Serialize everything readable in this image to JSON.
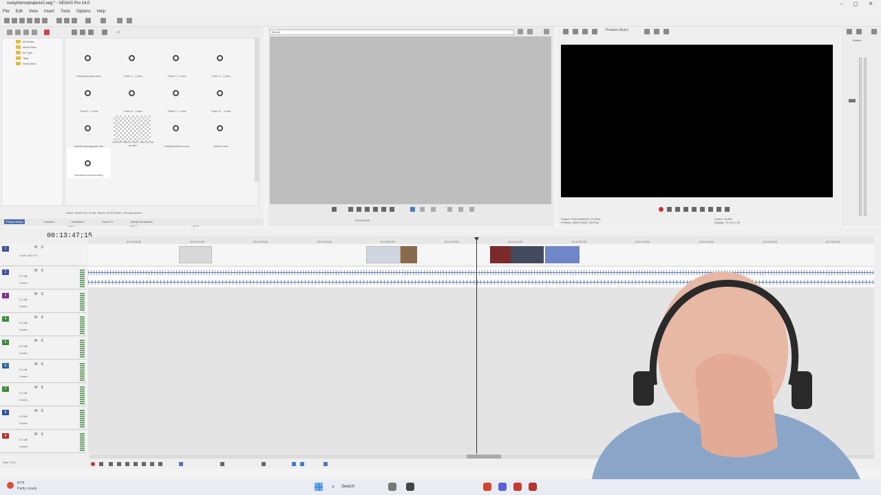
{
  "window": {
    "title": "rockyhorrorprojectv2.veg * - VEGAS Pro 14.0",
    "menus": [
      "File",
      "Edit",
      "View",
      "Insert",
      "Tools",
      "Options",
      "Help"
    ]
  },
  "media_tree": {
    "items": [
      "All Media",
      "Media Bins",
      "By Type",
      "Tags",
      "Smart Bins"
    ]
  },
  "media_items": [
    {
      "label": "theyveescaped.wav"
    },
    {
      "label": "Track 1 - 1.wav"
    },
    {
      "label": "Track 3 - 1.wav"
    },
    {
      "label": "Track 4 - 1.wav"
    },
    {
      "label": "Track 6 - 1.wav"
    },
    {
      "label": "Track 8 - 1.wav"
    },
    {
      "label": "Track 9 - 1.wav"
    },
    {
      "label": "Track 11 - 1.wav"
    },
    {
      "label": "transitionparagraph.wav"
    },
    {
      "label": "VEGAS Titles & Text 1 use my cat as filler"
    },
    {
      "label": "whatshouldnme.wav"
    },
    {
      "label": "whether.wav"
    },
    {
      "label": "wouldverrunthiscoming"
    }
  ],
  "shortcuts": {
    "col1": [
      "Ctrl+1",
      "Ctrl+2",
      "Ctrl+3"
    ],
    "col2": [
      "Ctrl+4",
      "Ctrl+5",
      "Ctrl+6"
    ],
    "col3": [
      "Ctrl+7",
      "Ctrl+8",
      "Ctrl+9"
    ],
    "col4": [
      "Ctrl"
    ]
  },
  "media_footer": "Audio: 48,000 Hz, 16 Bit, Stereo, 00:00:06;00, Uncompressed",
  "bottom_tabs": [
    "Project Media",
    "Explorer",
    "Transitions",
    "Video FX",
    "Media Generators"
  ],
  "trimmer": {
    "field": "(None)",
    "time": "00:00:00;00"
  },
  "preview": {
    "mode_label": "Preview (Auto)",
    "project_info": "Project: 1920x1080x32, 29.970p",
    "preview_info": "Preview: 480x270x32, 29.970p",
    "frame_info": "Frame: 24,861",
    "display_info": "Display: 79 x 44 x 32"
  },
  "master": {
    "label": "Master"
  },
  "timeline": {
    "time_display": "00:13:47;15",
    "level": "Level: 100.0 %",
    "ruler": [
      "00:13:08:00",
      "00:13:20:00",
      "00:13:30:00",
      "00:13:40:00",
      "00:13:50:00",
      "00:14:00:00",
      "00:14:10:00",
      "00:14:20:00",
      "00:14:30:00",
      "00:14:40:00",
      "00:14:50:00",
      "00:15:00:00"
    ],
    "tracks": [
      {
        "num": "1",
        "color": "#3a4fa0",
        "type": "video"
      },
      {
        "num": "2",
        "color": "#3a4fa0",
        "type": "audio"
      },
      {
        "num": "3",
        "color": "#7a2f88",
        "type": "audio"
      },
      {
        "num": "4",
        "color": "#3c8a3c",
        "type": "audio"
      },
      {
        "num": "5",
        "color": "#3c8a3c",
        "type": "audio"
      },
      {
        "num": "6",
        "color": "#2f6b9a",
        "type": "audio"
      },
      {
        "num": "7",
        "color": "#3c8a3c",
        "type": "audio"
      },
      {
        "num": "8",
        "color": "#2f4fa0",
        "type": "audio"
      },
      {
        "num": "9",
        "color": "#b5342c",
        "type": "audio"
      }
    ],
    "track_labels": {
      "vol": "Vol:",
      "db": "0.0 dB",
      "pan": "Pan:",
      "center": "Center",
      "touch": "Touch",
      "msb": "M S"
    },
    "rate": "Rate: 0.00"
  },
  "taskbar": {
    "temp": "67°F",
    "condition": "Partly cloudy",
    "search": "Search"
  }
}
